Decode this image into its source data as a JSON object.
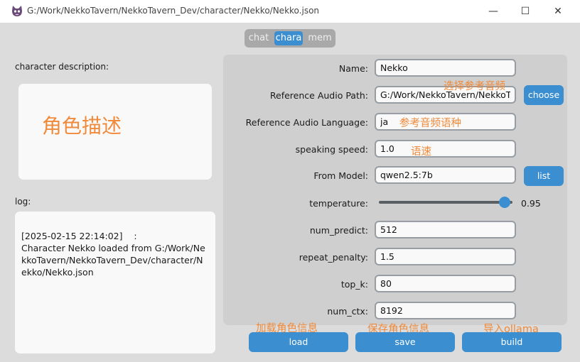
{
  "window": {
    "title": "G:/Work/NekkoTavern/NekkoTavern_Dev/character/Nekko/Nekko.json",
    "minimize": "—",
    "maximize": "☐",
    "close": "✕"
  },
  "tabs": [
    {
      "label": "chat",
      "active": false
    },
    {
      "label": "chara",
      "active": true
    },
    {
      "label": "mem",
      "active": false
    }
  ],
  "left": {
    "desc_label": "character description:",
    "desc_placeholder_text": "角色描述",
    "log_label": "log:",
    "log_text": "[2025-02-15 22:14:02]    :\nCharacter Nekko loaded from G:/Work/NekkoTavern/NekkoTavern_Dev/character/Nekko/Nekko.json"
  },
  "form": {
    "name": {
      "label": "Name:",
      "value": "Nekko"
    },
    "ref_audio_path": {
      "label": "Reference Audio Path:",
      "value": "G:/Work/NekkoTavern/NekkoTavern_Dev",
      "button": "choose",
      "annotation": "选择参考音频"
    },
    "ref_audio_lang": {
      "label": "Reference Audio Language:",
      "value": "ja",
      "annotation": "参考音频语种"
    },
    "speaking_speed": {
      "label": "speaking speed:",
      "value": "1.0",
      "annotation": "语速"
    },
    "from_model": {
      "label": "From Model:",
      "value": "qwen2.5:7b",
      "button": "list"
    },
    "temperature": {
      "label": "temperature:",
      "value": 0.95,
      "value_text": "0.95"
    },
    "num_predict": {
      "label": "num_predict:",
      "value": "512"
    },
    "repeat_penalty": {
      "label": "repeat_penalty:",
      "value": "1.5"
    },
    "top_k": {
      "label": "top_k:",
      "value": "80"
    },
    "num_ctx": {
      "label": "num_ctx:",
      "value": "8192"
    }
  },
  "actions": {
    "load": {
      "label": "load",
      "annotation": "加载角色信息"
    },
    "save": {
      "label": "save",
      "annotation": "保存角色信息"
    },
    "build": {
      "label": "build",
      "annotation": "导入ollama"
    }
  },
  "colors": {
    "accent": "#3b8ed0",
    "annotation": "#f08a3a",
    "background": "#dcdcdc"
  },
  "icons": {
    "app": "cat-avatar-icon",
    "minimize": "minimize-icon",
    "maximize": "maximize-icon",
    "close": "close-icon"
  }
}
